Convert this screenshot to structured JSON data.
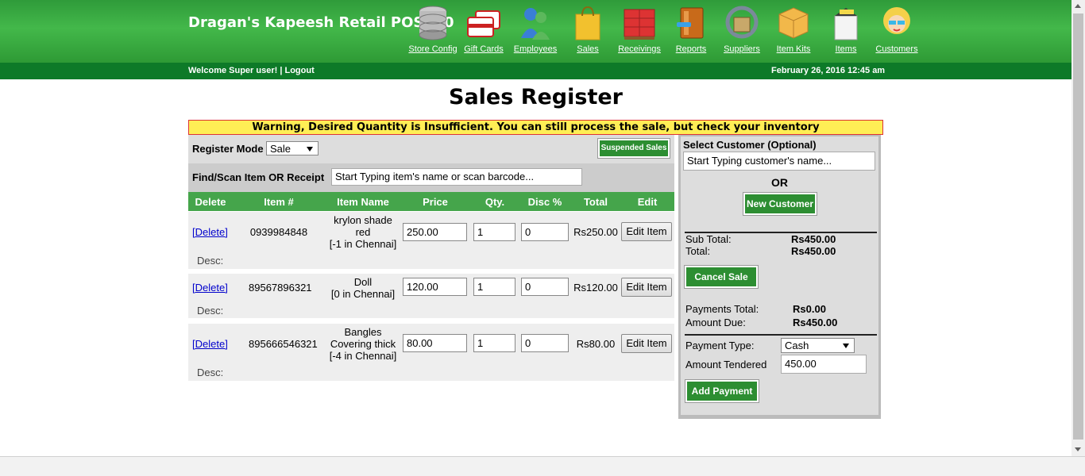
{
  "header": {
    "title": "Dragan's Kapeesh Retail POS 1.0",
    "nav": [
      {
        "label": "Store Config",
        "icon": "database-icon"
      },
      {
        "label": "Gift Cards",
        "icon": "gift-card-icon"
      },
      {
        "label": "Employees",
        "icon": "employees-icon"
      },
      {
        "label": "Sales",
        "icon": "shopping-bag-icon"
      },
      {
        "label": "Receivings",
        "icon": "crates-icon"
      },
      {
        "label": "Reports",
        "icon": "book-icon"
      },
      {
        "label": "Suppliers",
        "icon": "suppliers-icon"
      },
      {
        "label": "Item Kits",
        "icon": "boxes-icon"
      },
      {
        "label": "Items",
        "icon": "open-box-icon"
      },
      {
        "label": "Customers",
        "icon": "customer-icon"
      }
    ]
  },
  "subbar": {
    "welcome": "Welcome Super user!",
    "separator": "|",
    "logout": "Logout",
    "datetime": "February 26, 2016 12:45 am"
  },
  "page_title": "Sales Register",
  "warning": "Warning, Desired Quantity is Insufficient. You can still process the sale, but check your inventory",
  "register": {
    "mode_label": "Register Mode",
    "mode_value": "Sale",
    "suspended_label": "Suspended Sales",
    "find_label": "Find/Scan Item OR Receipt",
    "find_value": "Start Typing item's name or scan barcode..."
  },
  "cart": {
    "headers": [
      "Delete",
      "Item #",
      "Item Name",
      "Price",
      "Qty.",
      "Disc %",
      "Total",
      "Edit"
    ],
    "delete_label": "[Delete]",
    "edit_label": "Edit Item",
    "desc_label": "Desc:",
    "rows": [
      {
        "item_no": "0939984848",
        "name_lines": [
          "krylon shade",
          "red",
          "[-1 in Chennai]"
        ],
        "price": "250.00",
        "qty": "1",
        "disc": "0",
        "total": "Rs250.00"
      },
      {
        "item_no": "89567896321",
        "name_lines": [
          "Doll",
          "[0 in Chennai]"
        ],
        "price": "120.00",
        "qty": "1",
        "disc": "0",
        "total": "Rs120.00"
      },
      {
        "item_no": "895666546321",
        "name_lines": [
          "Bangles",
          "Covering thick",
          "[-4 in Chennai]"
        ],
        "price": "80.00",
        "qty": "1",
        "disc": "0",
        "total": "Rs80.00"
      }
    ]
  },
  "side": {
    "customer_label": "Select Customer (Optional)",
    "customer_value": "Start Typing customer's name...",
    "or_text": "OR",
    "new_customer": "New Customer",
    "subtotal_label": "Sub Total:",
    "subtotal_value": "Rs450.00",
    "total_label": "Total:",
    "total_value": "Rs450.00",
    "cancel_sale": "Cancel Sale",
    "payments_total_label": "Payments Total:",
    "payments_total_value": "Rs0.00",
    "amount_due_label": "Amount Due:",
    "amount_due_value": "Rs450.00",
    "payment_type_label": "Payment Type:",
    "payment_type_value": "Cash",
    "amount_tendered_label": "Amount Tendered",
    "amount_tendered_value": "450.00",
    "add_payment": "Add Payment"
  }
}
